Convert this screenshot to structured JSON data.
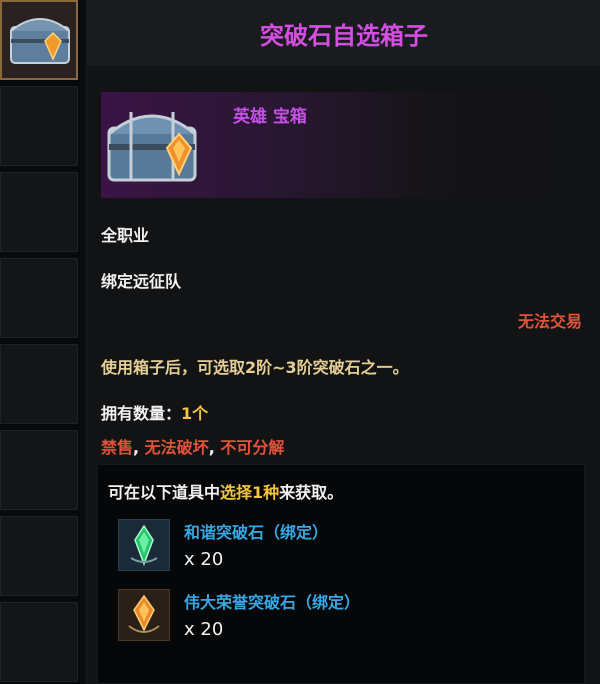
{
  "item": {
    "title": "突破石自选箱子",
    "grade": "英雄 宝箱",
    "class_req": "全职业",
    "binding": "绑定远征队",
    "trade": "无法交易",
    "description": "使用箱子后，可选取2阶~3阶突破石之一。",
    "count_label": "拥有数量：",
    "count_value": "1个",
    "restrictions": [
      "禁售",
      "无法破坏",
      "不可分解"
    ],
    "restriction_sep": ", "
  },
  "choice": {
    "prefix": "可在以下道具中",
    "highlight": "选择1种",
    "suffix": "来获取。",
    "rewards": [
      {
        "name": "和谐突破石（绑定）",
        "qty": "x 20",
        "icon": "green-crystal-icon"
      },
      {
        "name": "伟大荣誉突破石（绑定）",
        "qty": "x 20",
        "icon": "orange-crystal-icon"
      }
    ]
  },
  "colors": {
    "title": "#d24fe0",
    "grade": "#c450e6",
    "warning": "#e0553a",
    "description": "#e6cf94",
    "highlight": "#f5c542",
    "reward_name": "#35a8e6"
  }
}
